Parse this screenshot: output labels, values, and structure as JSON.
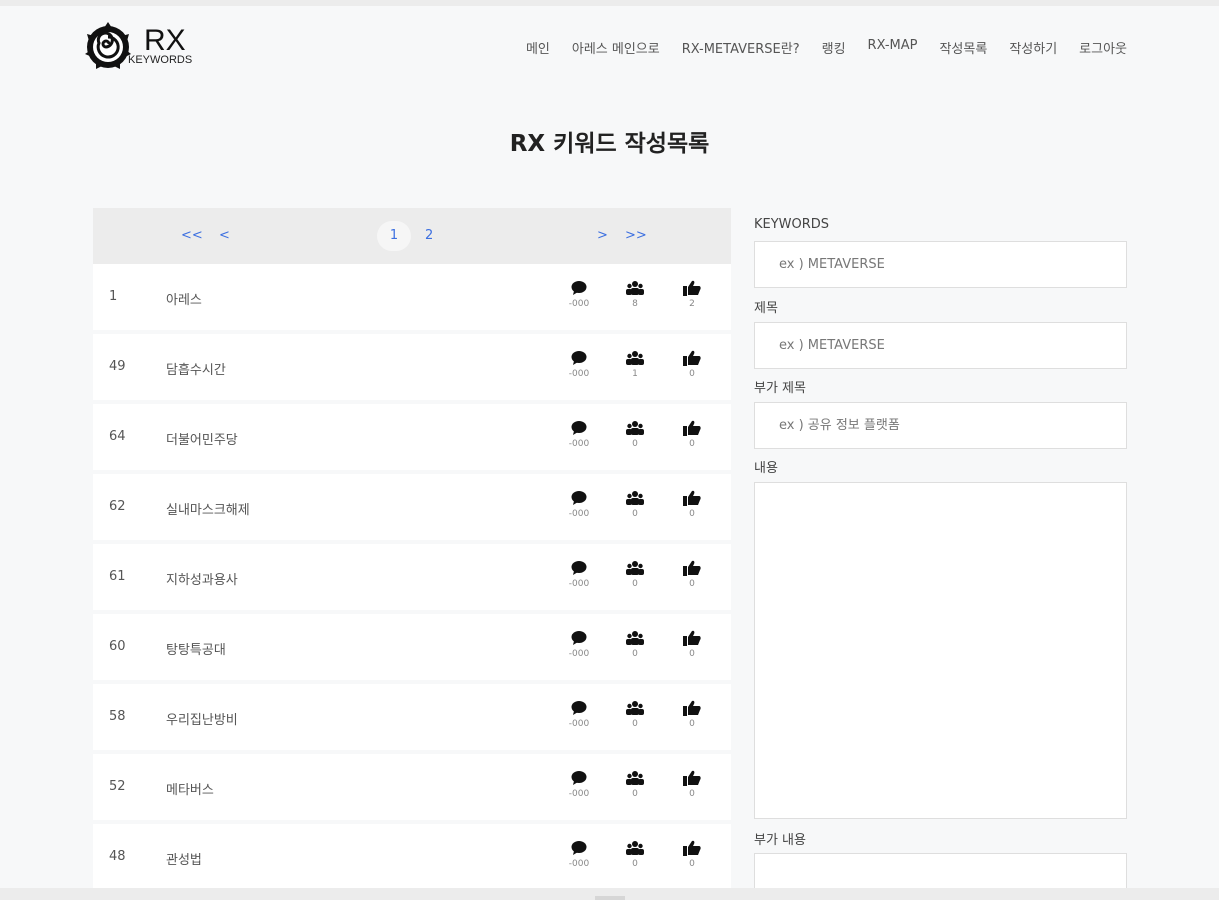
{
  "logo": {
    "title": "RX",
    "subtitle": "KEYWORDS"
  },
  "nav": [
    {
      "label": "메인"
    },
    {
      "label": "아레스 메인으로"
    },
    {
      "label": "RX-METAVERSE란?"
    },
    {
      "label": "랭킹"
    },
    {
      "label": "RX-MAP"
    },
    {
      "label": "작성목록"
    },
    {
      "label": "작성하기"
    },
    {
      "label": "로그아웃"
    }
  ],
  "page_title": "RX 키워드 작성목록",
  "pager": {
    "first": "<<",
    "prev": "<",
    "pages": [
      "1",
      "2"
    ],
    "current": "1",
    "next": ">",
    "last": ">>"
  },
  "rows": [
    {
      "num": "1",
      "keyword": "아레스",
      "comments": "-000",
      "users": "8",
      "likes": "2"
    },
    {
      "num": "49",
      "keyword": "담흡수시간",
      "comments": "-000",
      "users": "1",
      "likes": "0"
    },
    {
      "num": "64",
      "keyword": "더불어민주당",
      "comments": "-000",
      "users": "0",
      "likes": "0"
    },
    {
      "num": "62",
      "keyword": "실내마스크해제",
      "comments": "-000",
      "users": "0",
      "likes": "0"
    },
    {
      "num": "61",
      "keyword": "지하성과용사",
      "comments": "-000",
      "users": "0",
      "likes": "0"
    },
    {
      "num": "60",
      "keyword": "탕탕특공대",
      "comments": "-000",
      "users": "0",
      "likes": "0"
    },
    {
      "num": "58",
      "keyword": "우리집난방비",
      "comments": "-000",
      "users": "0",
      "likes": "0"
    },
    {
      "num": "52",
      "keyword": "메타버스",
      "comments": "-000",
      "users": "0",
      "likes": "0"
    },
    {
      "num": "48",
      "keyword": "관성법",
      "comments": "-000",
      "users": "0",
      "likes": "0"
    }
  ],
  "form": {
    "keywords_label": "KEYWORDS",
    "keywords_placeholder": "ex ) METAVERSE",
    "title_label": "제목",
    "title_placeholder": "ex ) METAVERSE",
    "subtitle_label": "부가 제목",
    "subtitle_placeholder": "ex ) 공유 정보 플랫폼",
    "content_label": "내용",
    "extra_content_label": "부가 내용"
  },
  "icons": {
    "comment": "speech-bubble-icon",
    "users": "users-group-icon",
    "like": "thumbs-up-icon"
  }
}
